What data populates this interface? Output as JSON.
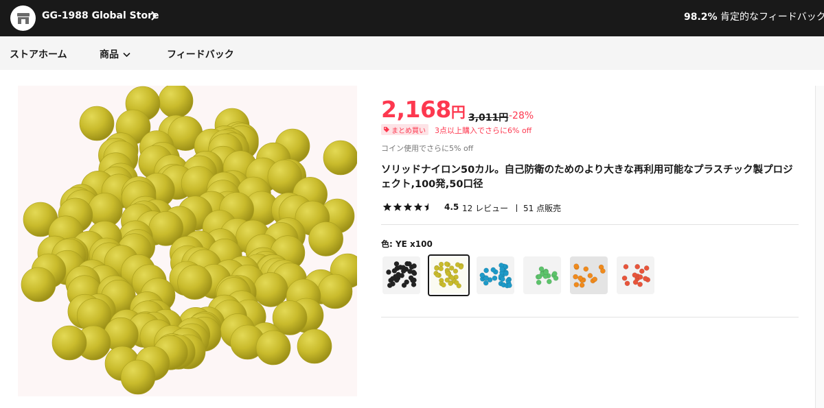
{
  "store": {
    "name": "GG-1988 Global Store",
    "feedback_rate": "98.2%",
    "feedback_label": " 肯定的なフィードバック"
  },
  "nav": {
    "home": "ストアホーム",
    "products": "商品",
    "feedback": "フィードバック"
  },
  "product": {
    "price": "2,168",
    "price_unit": "円",
    "old_price": "3,011円",
    "discount": "-28%",
    "bundle_badge": "まとめ買い",
    "bundle_text": "3点以上購入でさらに6% off",
    "coin_text": "コイン使用でさらに5% off",
    "title": "ソリッドナイロン50カル。自己防衛のためのより大きな再利用可能なプラスチック製プロジェクト,100発,50口径",
    "rating": "4.5",
    "rating_value": 4.5,
    "reviews": "12 レビュー",
    "sold": "51 点販売",
    "color_label": "色: YE x100",
    "swatches": [
      {
        "name": "black",
        "color": "#222222",
        "selected": false
      },
      {
        "name": "yellow",
        "color": "#c9bb2c",
        "selected": true
      },
      {
        "name": "blue",
        "color": "#1e9ac8",
        "selected": false
      },
      {
        "name": "green",
        "color": "#5cc36b",
        "selected": false
      },
      {
        "name": "orange",
        "color": "#f08a1c",
        "selected": false
      },
      {
        "name": "red",
        "color": "#e8553b",
        "selected": false
      }
    ]
  },
  "colors": {
    "accent": "#fd384f",
    "header_bg": "#191919",
    "nav_bg": "#f5f5f5",
    "ball_yellow": "#c9bb2c"
  }
}
